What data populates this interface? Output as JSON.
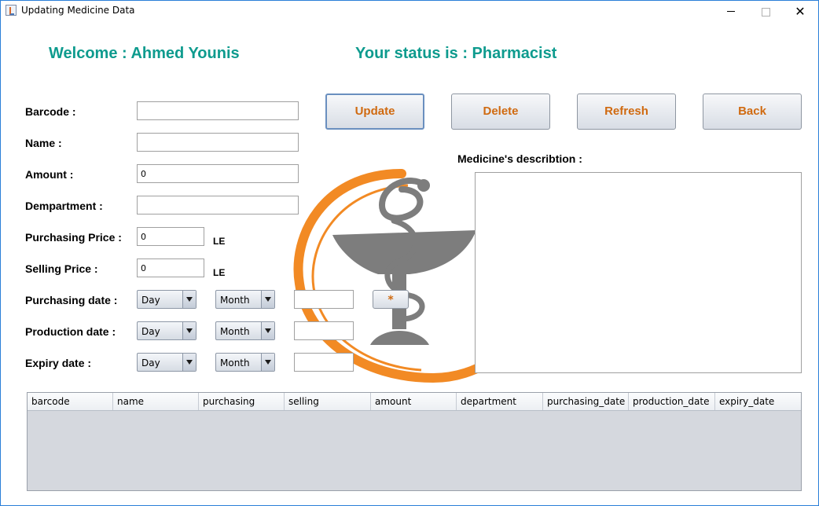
{
  "window": {
    "title": "Updating Medicine Data",
    "minimize": "—",
    "maximize": "☐",
    "close": "✕"
  },
  "header": {
    "welcome": "Welcome : Ahmed Younis",
    "status": "Your status is : Pharmacist"
  },
  "form": {
    "barcode_label": "Barcode :",
    "barcode_value": "",
    "name_label": "Name :",
    "name_value": "",
    "amount_label": "Amount :",
    "amount_value": "0",
    "department_label": "Dempartment :",
    "department_value": "",
    "purchasing_price_label": "Purchasing Price :",
    "purchasing_price_value": "0",
    "selling_price_label": "Selling Price :",
    "selling_price_value": "0",
    "currency": "LE",
    "purchasing_date_label": "Purchasing date :",
    "production_date_label": "Production date :",
    "expiry_date_label": "Expiry date :",
    "day_placeholder": "Day",
    "month_placeholder": "Month",
    "star_button": "*"
  },
  "actions": {
    "update": "Update",
    "delete": "Delete",
    "refresh": "Refresh",
    "back": "Back"
  },
  "description": {
    "label": "Medicine's describtion :"
  },
  "table": {
    "columns": [
      "barcode",
      "name",
      "purchasing",
      "selling",
      "amount",
      "department",
      "purchasing_date",
      "production_date",
      "expiry_date"
    ],
    "rows": []
  },
  "colors": {
    "accent_teal": "#0e9b8e",
    "button_text_orange": "#d06a10",
    "logo_orange": "#f28a24",
    "logo_gray": "#7d7d7d"
  }
}
